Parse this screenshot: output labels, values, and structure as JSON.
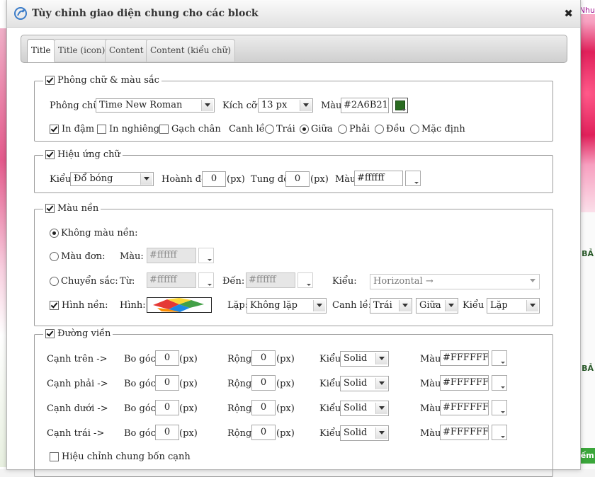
{
  "background": {
    "top_link": "Nhu",
    "right_label": "BẢ",
    "right_button": "iếm"
  },
  "dialog": {
    "title": "Tùy chỉnh giao diện chung cho các block",
    "close_symbol": "✖"
  },
  "tabs": [
    {
      "label": "Title",
      "active": true
    },
    {
      "label": "Title (icon)",
      "active": false
    },
    {
      "label": "Content",
      "active": false
    },
    {
      "label": "Content (kiểu chữ)",
      "active": false
    }
  ],
  "font_section": {
    "legend": "Phông chữ & màu sắc",
    "enabled": true,
    "font_label": "Phông chữ:",
    "font_value": "Time New Roman",
    "size_label": "Kích cỡ:",
    "size_value": "13 px",
    "color_label": "Màu:",
    "color_value": "#2A6B21",
    "bold_label": "In đậm",
    "bold": true,
    "italic_label": "In nghiêng",
    "italic": false,
    "underline_label": "Gạch chân",
    "underline": false,
    "align_label": "Canh lề:",
    "align_options": [
      "Trái",
      "Giữa",
      "Phải",
      "Đều",
      "Mặc định"
    ],
    "align_selected": "Giữa"
  },
  "effect_section": {
    "legend": "Hiệu ứng chữ",
    "enabled": true,
    "type_label": "Kiểu:",
    "type_value": "Đổ bóng",
    "h_label": "Hoành độ:",
    "h_value": "0",
    "v_label": "Tung độ:",
    "v_value": "0",
    "unit": "(px)",
    "color_label": "Màu:",
    "color_value": "#ffffff"
  },
  "bg_section": {
    "legend": "Màu nền",
    "enabled": true,
    "none_label": "Không màu nền:",
    "solid_label": "Màu đơn:",
    "solid_color_label": "Màu:",
    "solid_color": "#ffffff",
    "gradient_label": "Chuyển sắc:",
    "from_label": "Từ:",
    "from_color": "#ffffff",
    "to_label": "Đến:",
    "to_color": "#ffffff",
    "gradient_type_label": "Kiểu:",
    "gradient_type": "Horizontal →",
    "selected_mode": "none",
    "image_label": "Hình nền:",
    "image_enabled": true,
    "image_field_label": "Hình:",
    "repeat_label": "Lặp:",
    "repeat_value": "Không lặp",
    "align_label": "Canh lề:",
    "align_h": "Trái",
    "align_v": "Giữa",
    "type_label": "Kiểu",
    "type_value": "Lặp"
  },
  "border_section": {
    "legend": "Đường viền",
    "enabled": true,
    "radius_label": "Bo góc:",
    "width_label": "Rộng:",
    "style_label": "Kiểu:",
    "color_label": "Màu:",
    "unit": "(px)",
    "sides": [
      {
        "label": "Cạnh trên ->",
        "radius": "0",
        "width": "0",
        "style": "Solid",
        "color": "#FFFFFF"
      },
      {
        "label": "Cạnh phải ->",
        "radius": "0",
        "width": "0",
        "style": "Solid",
        "color": "#FFFFFF"
      },
      {
        "label": "Cạnh dưới ->",
        "radius": "0",
        "width": "0",
        "style": "Solid",
        "color": "#FFFFFF"
      },
      {
        "label": "Cạnh trái ->",
        "radius": "0",
        "width": "0",
        "style": "Solid",
        "color": "#FFFFFF"
      }
    ],
    "sync_label": "Hiệu chỉnh chung bốn cạnh",
    "sync": false
  }
}
